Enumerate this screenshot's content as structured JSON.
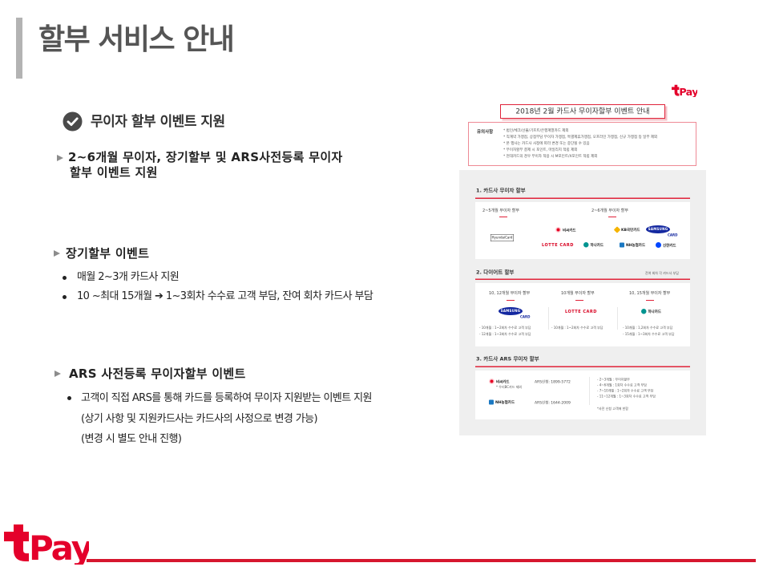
{
  "slide": {
    "title": "할부 서비스 안내",
    "heading": "무이자 할부 이벤트 지원",
    "intro": {
      "line1": "2~6개월 무이자, 장기할부 및 ARS사전등록 무이자",
      "line2": "할부 이벤트 지원"
    },
    "long_term": {
      "title": "장기할부 이벤트",
      "bullets": [
        "매월 2~3개 카드사 지원",
        "10 ~최대 15개월 ➔ 1~3회차 수수료 고객 부담, 잔여 회차 카드사 부담"
      ]
    },
    "ars": {
      "title": "ARS 사전등록 무이자할부 이벤트",
      "bullet": "고객이 직접 ARS를 통해 카드를 등록하여 무이자 지원받는 이벤트 지원",
      "notes": [
        "(상기 사항 및 지원카드사는 카드사의 사정으로 변경 가능)",
        "(변경 시 별도 안내 진행)"
      ]
    }
  },
  "brand": {
    "wordmark": "Pay",
    "color": "#e4002b"
  },
  "notice": {
    "title": "2018년 2월 카드사 무이자할부 이벤트 안내",
    "caution_label": "유의사항",
    "cautions": [
      "* 법인/체크/선불/기프트/은행계열카드 제외",
      "* 직계약 가맹점, 상점부담 무이자 가맹점, 특별제휴가맹점, 오프라인 가맹점, 신규 가맹점 등 일부 제외",
      "* 본 행사는 카드사 사정에 따라 변경 또는 중단될 수 있음",
      "* 무이자할부 결제 시 포인트, 마일리지 적립 제외",
      "* 현대카드의 경우 무이자 적용 시 M포인트/X포인트 적립 제외"
    ],
    "section1": {
      "title": "1. 카드사 무이자 할부",
      "labels": [
        "2~5개월 무이자 할부",
        "2~6개월 무이자 할부"
      ],
      "cards": {
        "hyundai": "HyundaiCard",
        "bc": "비씨카드",
        "kb": "KB국민카드",
        "samsung": "SAMSUNG",
        "samsung_sub": "CARD",
        "lotte": "LOTTE CARD",
        "hana": "하나카드",
        "nh": "NH농협카드",
        "shinhan": "신한카드"
      }
    },
    "section2": {
      "title": "2. 다이어트 할부",
      "note": "잔여 회차 각 카드사 부담",
      "columns": [
        {
          "label": "10, 12개월 무이자 할부",
          "card": "SAMSUNG",
          "card_sub": "CARD",
          "lines": [
            "- 10개월 : 1~2회차 수수료 고객 부담",
            "- 12개월 : 1~3회차 수수료 고객 부담"
          ]
        },
        {
          "label": "10개월 무이자 할부",
          "card": "LOTTE CARD",
          "lines": [
            "- 10개월 : 1~2회차 수수료 고객 부담"
          ]
        },
        {
          "label": "10, 15개월 무이자 할부",
          "card": "하나카드",
          "lines": [
            "- 10개월 : 1,2회차 수수료 고객 부담",
            "- 15개월 : 1~3회차 수수료 고객 부담"
          ]
        }
      ]
    },
    "section3": {
      "title": "3. 카드사 ARS 무이자 할부",
      "rows": [
        {
          "card": "비씨카드",
          "note": "* 우리BC카드 제외",
          "phone": "ARS신청: 1899-5772"
        },
        {
          "card": "NH농협카드",
          "phone": "ARS신청: 1644-2009"
        }
      ],
      "terms": [
        "- 2~3개월 : 무이자할부",
        "- 4~6개월 : 1회차 수수료 고객 부담",
        "- 7~10개월 : 1~2회차 수수료 고객 부담",
        "- 11~12개월 : 1~3회차 수수료 고객 부담"
      ],
      "footnote": "*사전 신청 고객에 한함"
    }
  }
}
